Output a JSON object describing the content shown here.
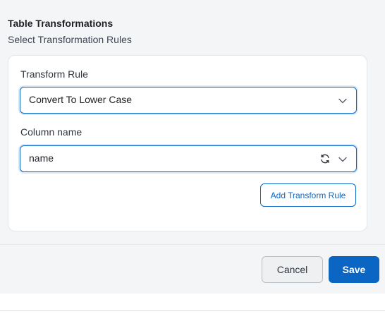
{
  "header": {
    "title": "Table Transformations",
    "subtitle": "Select Transformation Rules"
  },
  "form": {
    "transform_rule": {
      "label": "Transform Rule",
      "value": "Convert To Lower Case"
    },
    "column_name": {
      "label": "Column name",
      "value": "name"
    },
    "add_rule_label": "Add Transform Rule"
  },
  "footer": {
    "cancel_label": "Cancel",
    "save_label": "Save"
  },
  "icons": {
    "dropdown": "chevron-down-icon",
    "refresh": "refresh-icon"
  },
  "colors": {
    "accent": "#0b66c3",
    "panel_bg": "#f4f5f7"
  }
}
